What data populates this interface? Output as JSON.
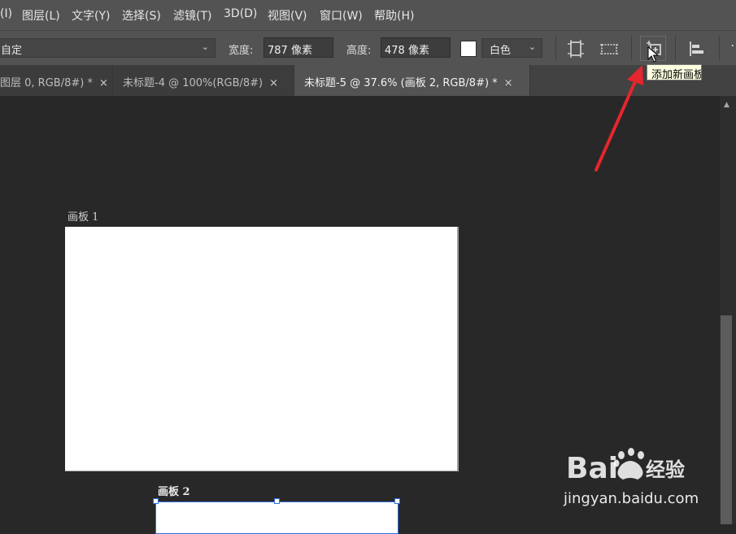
{
  "menubar": {
    "items": [
      "(I)",
      "图层(L)",
      "文字(Y)",
      "选择(S)",
      "滤镜(T)",
      "3D(D)",
      "视图(V)",
      "窗口(W)",
      "帮助(H)"
    ]
  },
  "options": {
    "preset": "自定",
    "width_label": "宽度:",
    "width_value": "787 像素",
    "height_label": "高度:",
    "height_value": "478 像素",
    "background_value": "白色",
    "swatch_color": "#ffffff"
  },
  "tabs": [
    {
      "label": "图层 0, RGB/8#) *",
      "close": "×",
      "active": false
    },
    {
      "label": "未标题-4 @ 100%(RGB/8#)",
      "close": "×",
      "active": false
    },
    {
      "label": "未标题-5 @ 37.6% (画板 2, RGB/8#) *",
      "close": "×",
      "active": true
    }
  ],
  "tooltip": {
    "text": "添加新画板"
  },
  "artboards": [
    {
      "label": "画板 1"
    },
    {
      "label": "画板 2"
    }
  ],
  "colors": {
    "arrow": "#e5262d",
    "selection": "#2f6fe0"
  },
  "watermark": {
    "brand_left": "Bai",
    "brand_right": "经验",
    "url": "jingyan.baidu.com"
  }
}
